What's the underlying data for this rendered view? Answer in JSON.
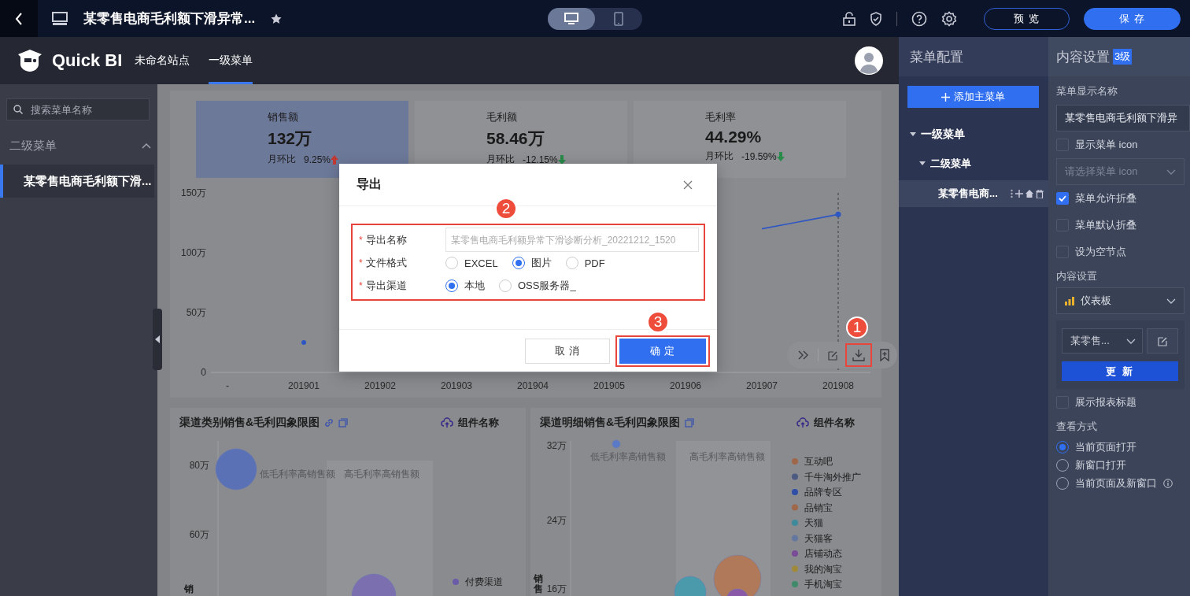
{
  "top_bar": {
    "title": "某零售电商毛利额下滑异常...",
    "device_modes": [
      {
        "kind": "desktop",
        "selected": true
      },
      {
        "kind": "mobile",
        "selected": false
      }
    ],
    "buttons": [
      {
        "label": "预 览",
        "kind": "secondary"
      },
      {
        "label": "保 存",
        "kind": "primary"
      }
    ]
  },
  "site_header": {
    "brand": "Quick BI",
    "site_name": "未命名站点",
    "nav": [
      {
        "label": "一级菜单",
        "selected": true
      }
    ]
  },
  "sidebar": {
    "search": {
      "placeholder": "搜索菜单名称"
    },
    "groups": [
      {
        "label": "二级菜单",
        "expanded": true,
        "children": [
          {
            "label": "某零售电商毛利额下滑...",
            "selected": true
          }
        ]
      }
    ]
  },
  "dashboard": {
    "kpis": [
      {
        "label": "销售额",
        "value": "132万",
        "compare_label": "月环比",
        "compare_value": "9.25%",
        "trend_up": true,
        "selected": true
      },
      {
        "label": "毛利额",
        "value": "58.46万",
        "compare_label": "月环比",
        "compare_value": "-12.15%",
        "trend_up": false,
        "selected": false
      },
      {
        "label": "毛利率",
        "value": "44.29%",
        "compare_label": "月环比",
        "compare_value": "-19.59%",
        "trend_up": false,
        "selected": false
      }
    ],
    "trend_chart": {
      "chart_data": {
        "type": "line",
        "categories": [
          "-",
          "201901",
          "201902",
          "201903",
          "201904",
          "201905",
          "201906",
          "201907",
          "201908"
        ],
        "series": [
          {
            "color": "#2f57c4",
            "values": [
              null,
              25,
              null,
              null,
              null,
              null,
              null,
              120,
              132
            ]
          }
        ],
        "ylim": [
          0,
          150
        ],
        "yticks": [
          {
            "value": 0,
            "label": "0"
          },
          {
            "value": 50,
            "label": "50万"
          },
          {
            "value": 100,
            "label": "100万"
          },
          {
            "value": 150,
            "label": "150万"
          }
        ]
      }
    },
    "quadrant_charts": [
      {
        "title": "渠道类别销售&毛利四象限图",
        "linked": true,
        "component_label": "组件名称",
        "y_ticks": [
          "80万",
          "60万"
        ],
        "y_axis_label": "销",
        "quadrant_labels": [
          "低毛利率高销售额",
          "高毛利率高销售额"
        ],
        "legend": [
          {
            "label": "付费渠道",
            "color": "#6b5ca8"
          }
        ]
      },
      {
        "title": "渠道明细销售&毛利四象限图",
        "linked": false,
        "component_label": "组件名称",
        "y_ticks": [
          "32万",
          "24万",
          "16万"
        ],
        "y_axis_label": "销售",
        "quadrant_labels": [
          "低毛利率高销售额",
          "高毛利率高销售额"
        ],
        "legend": [
          {
            "label": "互动吧",
            "color": "#a0674a"
          },
          {
            "label": "千牛淘外推广",
            "color": "#4d5a82"
          },
          {
            "label": "品牌专区",
            "color": "#2f4fa8"
          },
          {
            "label": "品销宝",
            "color": "#a0674a"
          },
          {
            "label": "天猫",
            "color": "#3f8a9a"
          },
          {
            "label": "天猫客",
            "color": "#6377a0"
          },
          {
            "label": "店铺动态",
            "color": "#7a4c98"
          },
          {
            "label": "我的淘宝",
            "color": "#a08a3a"
          },
          {
            "label": "手机淘宝",
            "color": "#3f8a6a"
          }
        ]
      }
    ]
  },
  "export_dialog": {
    "title": "导出",
    "fields": [
      {
        "kind": "text",
        "label": "导出名称",
        "required_mark": "*",
        "placeholder": "某零售电商毛利额异常下滑诊断分析_20221212_1520"
      },
      {
        "kind": "radio",
        "label": "文件格式",
        "required_mark": "*",
        "options": [
          {
            "label": "EXCEL",
            "selected": false
          },
          {
            "label": "图片",
            "selected": true
          },
          {
            "label": "PDF",
            "selected": false
          }
        ]
      },
      {
        "kind": "radio",
        "label": "导出渠道",
        "required_mark": "*",
        "options": [
          {
            "label": "本地",
            "selected": true
          },
          {
            "label": "OSS服务器_",
            "selected": false
          }
        ]
      }
    ],
    "buttons": [
      {
        "label": "取 消",
        "kind": "secondary"
      },
      {
        "label": "确 定",
        "kind": "primary"
      }
    ]
  },
  "annotations": [
    {
      "number": "1"
    },
    {
      "number": "2"
    },
    {
      "number": "3"
    }
  ],
  "menu_config": {
    "title": "菜单配置",
    "add_button": "添加主菜单",
    "tree": [
      {
        "label": "一级菜单",
        "expanded": true,
        "children": [
          {
            "label": "二级菜单",
            "expanded": true,
            "children": [
              {
                "label": "某零售电商...",
                "selected": true
              }
            ]
          }
        ]
      }
    ]
  },
  "content_settings": {
    "title": "内容设置",
    "level_badge": "3级",
    "name_label": "菜单显示名称",
    "name_value": "某零售电商毛利额下滑异",
    "options": [
      {
        "kind": "checkbox",
        "label": "显示菜单 icon",
        "checked": false
      },
      {
        "kind": "select",
        "placeholder": "请选择菜单 icon",
        "disabled": true
      },
      {
        "kind": "checkbox",
        "label": "菜单允许折叠",
        "checked": true
      },
      {
        "kind": "checkbox",
        "label": "菜单默认折叠",
        "checked": false
      },
      {
        "kind": "checkbox",
        "label": "设为空节点",
        "checked": false
      },
      {
        "kind": "heading",
        "label": "内容设置"
      },
      {
        "kind": "content_picker",
        "type_value": "仪表板",
        "report_value": "某零售...",
        "update_button": "更 新"
      },
      {
        "kind": "checkbox",
        "label": "展示报表标题",
        "checked": false
      },
      {
        "kind": "heading",
        "label": "查看方式"
      },
      {
        "kind": "radio",
        "label": "当前页面打开",
        "selected": true,
        "info": false
      },
      {
        "kind": "radio",
        "label": "新窗口打开",
        "selected": false,
        "info": false
      },
      {
        "kind": "radio",
        "label": "当前页面及新窗口",
        "selected": false,
        "info": true
      }
    ]
  }
}
